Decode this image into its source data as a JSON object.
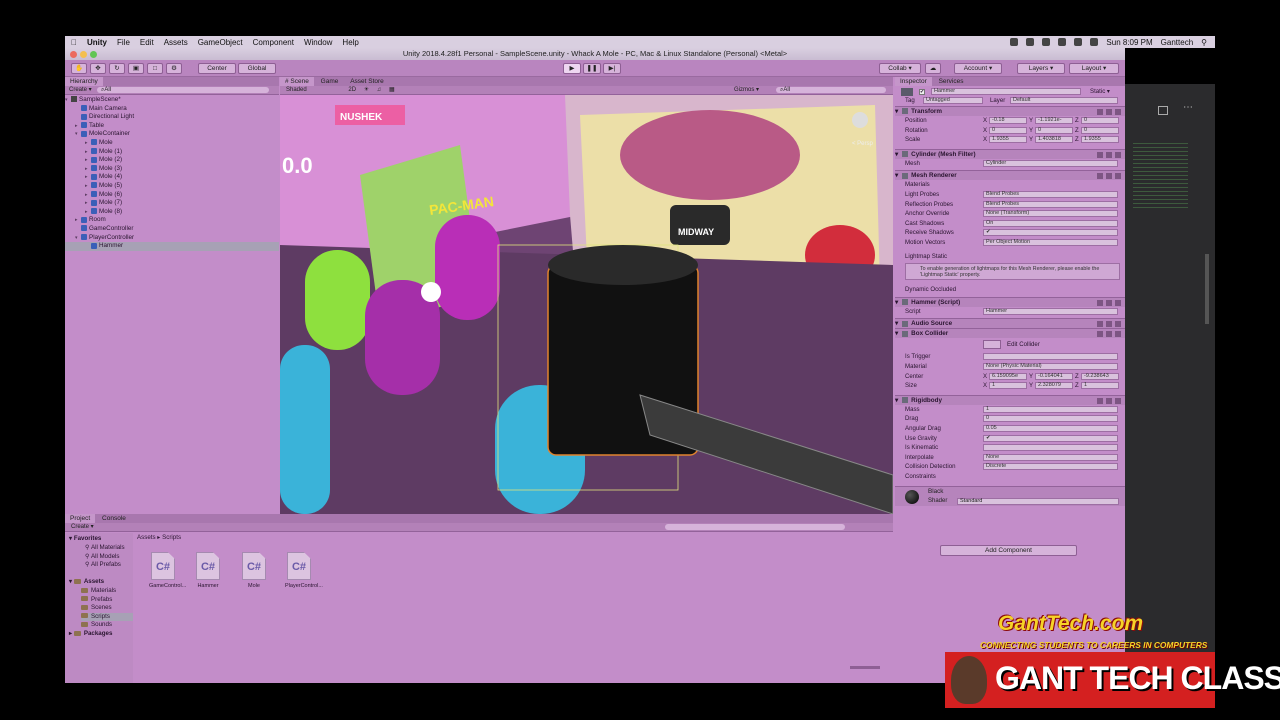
{
  "menubar": {
    "apple": "",
    "items": [
      "Unity",
      "File",
      "Edit",
      "Assets",
      "GameObject",
      "Component",
      "Window",
      "Help"
    ],
    "clock": "Sun 8:09 PM",
    "user": "Ganttech"
  },
  "window": {
    "title": "Unity 2018.4.28f1 Personal - SampleScene.unity - Whack A Mole - PC, Mac & Linux Standalone (Personal) <Metal>"
  },
  "toolbar": {
    "center": "Center",
    "global": "Global",
    "collab": "Collab ▾",
    "account": "Account ▾",
    "layers": "Layers ▾",
    "layout": "Layout ▾"
  },
  "hierarchy": {
    "tab": "Hierarchy",
    "create": "Create ▾",
    "search": "⌕All",
    "scene": "SampleScene*",
    "items": [
      {
        "label": "Main Camera",
        "indent": 1,
        "arrow": ""
      },
      {
        "label": "Directional Light",
        "indent": 1,
        "arrow": ""
      },
      {
        "label": "Table",
        "indent": 1,
        "arrow": "▸"
      },
      {
        "label": "MoleContainer",
        "indent": 1,
        "arrow": "▾"
      },
      {
        "label": "Mole",
        "indent": 2,
        "arrow": "▸"
      },
      {
        "label": "Mole (1)",
        "indent": 2,
        "arrow": "▸"
      },
      {
        "label": "Mole (2)",
        "indent": 2,
        "arrow": "▸"
      },
      {
        "label": "Mole (3)",
        "indent": 2,
        "arrow": "▸"
      },
      {
        "label": "Mole (4)",
        "indent": 2,
        "arrow": "▸"
      },
      {
        "label": "Mole (5)",
        "indent": 2,
        "arrow": "▸"
      },
      {
        "label": "Mole (6)",
        "indent": 2,
        "arrow": "▸"
      },
      {
        "label": "Mole (7)",
        "indent": 2,
        "arrow": "▸"
      },
      {
        "label": "Mole (8)",
        "indent": 2,
        "arrow": "▸"
      },
      {
        "label": "Room",
        "indent": 1,
        "arrow": "▸"
      },
      {
        "label": "GameController",
        "indent": 1,
        "arrow": ""
      },
      {
        "label": "PlayerController",
        "indent": 1,
        "arrow": "▾"
      },
      {
        "label": "Hammer",
        "indent": 2,
        "arrow": "",
        "selected": true
      }
    ]
  },
  "scene": {
    "tabs": [
      "# Scene",
      "Game",
      "Asset Store"
    ],
    "shading": "Shaded",
    "mode2d": "2D",
    "gizmos": "Gizmos ▾",
    "search": "⌕All",
    "persp": "< Persp",
    "sign_text": "NUSHEK",
    "score": "0.0",
    "pacman": "PAC-MAN",
    "midway": "MIDWAY"
  },
  "inspector": {
    "tabs": [
      "Inspector",
      "Services"
    ],
    "object": "Hammer",
    "static": "Static ▾",
    "tag_label": "Tag",
    "tag": "Untagged",
    "layer_label": "Layer",
    "layer": "Default",
    "transform": {
      "title": "Transform",
      "rows": [
        {
          "label": "Position",
          "x": "-0.18",
          "y": "-1.1921e-",
          "z": "0"
        },
        {
          "label": "Rotation",
          "x": "0",
          "y": "0",
          "z": "0"
        },
        {
          "label": "Scale",
          "x": "1.9355",
          "y": "1.403818",
          "z": "1.9355"
        }
      ]
    },
    "mesh_filter": {
      "title": "Cylinder (Mesh Filter)",
      "mesh_label": "Mesh",
      "mesh": "Cylinder"
    },
    "mesh_renderer": {
      "title": "Mesh Renderer",
      "materials": "Materials",
      "rows": [
        {
          "label": "Light Probes",
          "value": "Blend Probes"
        },
        {
          "label": "Reflection Probes",
          "value": "Blend Probes"
        },
        {
          "label": "Anchor Override",
          "value": "None (Transform)"
        },
        {
          "label": "Cast Shadows",
          "value": "On"
        },
        {
          "label": "Receive Shadows",
          "value": "✔"
        },
        {
          "label": "Motion Vectors",
          "value": "Per Object Motion"
        }
      ],
      "lightmap_static": "Lightmap Static",
      "info": "To enable generation of lightmaps for this Mesh Renderer, please enable the 'Lightmap Static' property.",
      "dynamic_occluded": "Dynamic Occluded"
    },
    "hammer_script": {
      "title": "Hammer (Script)",
      "script_label": "Script",
      "script": "Hammer"
    },
    "audio_source": {
      "title": "Audio Source"
    },
    "box_collider": {
      "title": "Box Collider",
      "edit": "Edit Collider",
      "rows": [
        {
          "label": "Is Trigger",
          "value": ""
        },
        {
          "label": "Material",
          "value": "None (Physic Material)"
        }
      ],
      "center": {
        "label": "Center",
        "x": "6.159095e",
        "y": "-0.164041",
        "z": "-9.238643"
      },
      "size": {
        "label": "Size",
        "x": "1",
        "y": "2.328079",
        "z": "1"
      }
    },
    "rigidbody": {
      "title": "Rigidbody",
      "rows": [
        {
          "label": "Mass",
          "value": "1"
        },
        {
          "label": "Drag",
          "value": "0"
        },
        {
          "label": "Angular Drag",
          "value": "0.05"
        },
        {
          "label": "Use Gravity",
          "value": "✔"
        },
        {
          "label": "Is Kinematic",
          "value": ""
        },
        {
          "label": "Interpolate",
          "value": "None"
        },
        {
          "label": "Collision Detection",
          "value": "Discrete"
        }
      ],
      "constraints": "Constraints"
    },
    "material": {
      "name": "Black",
      "shader_label": "Shader",
      "shader": "Standard"
    },
    "add_component": "Add Component"
  },
  "project": {
    "tabs": [
      "Project",
      "Console"
    ],
    "create": "Create ▾",
    "path": [
      "Assets",
      "Scripts"
    ],
    "favorites": {
      "label": "Favorites",
      "items": [
        "All Materials",
        "All Models",
        "All Prefabs"
      ]
    },
    "assets": {
      "label": "Assets",
      "items": [
        "Materials",
        "Prefabs",
        "Scenes",
        "Scripts",
        "Sounds"
      ]
    },
    "packages": "Packages",
    "scripts": [
      {
        "icon": "C#",
        "name": "GameControl..."
      },
      {
        "icon": "C#",
        "name": "Hammer"
      },
      {
        "icon": "C#",
        "name": "Mole"
      },
      {
        "icon": "C#",
        "name": "PlayerControl..."
      }
    ]
  },
  "branding": {
    "site": "GantTech.com",
    "tagline": "CONNECTING STUDENTS TO CAREERS IN COMPUTERS",
    "class": "GANT TECH CLASS"
  },
  "colors": {
    "panel": "#c38dc9",
    "header": "#a877ae",
    "selection": "#a7a1b5",
    "brand_yellow": "#f6d328",
    "brand_red": "#d42020"
  }
}
